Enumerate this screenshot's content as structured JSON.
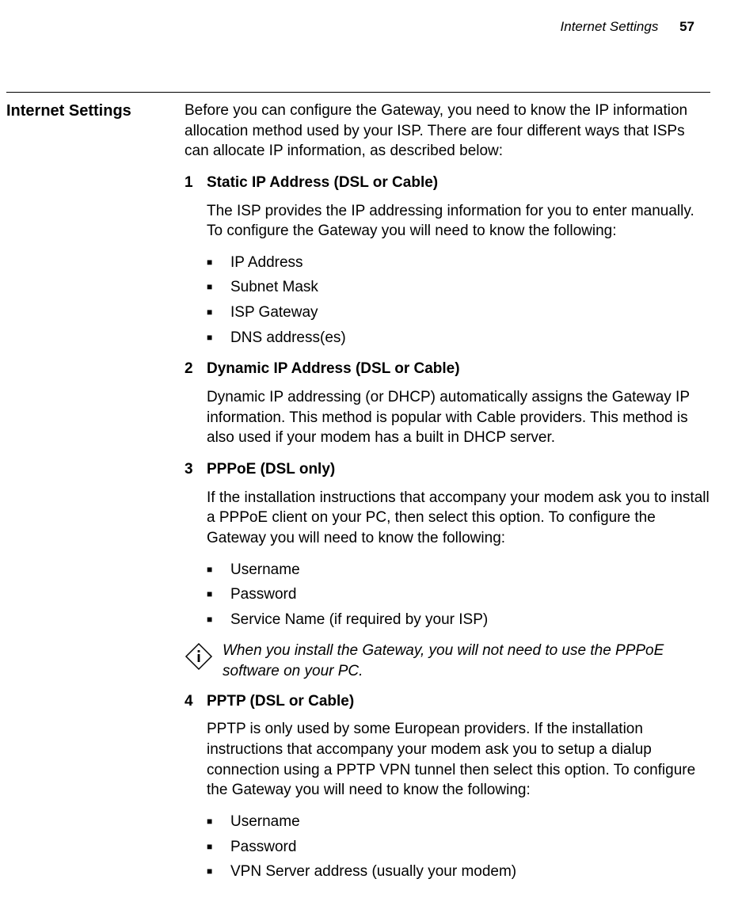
{
  "runningHead": {
    "title": "Internet Settings",
    "pageNumber": "57"
  },
  "sideHeading": "Internet Settings",
  "intro": "Before you can configure the Gateway, you need to know the IP information allocation method used by your ISP. There are four different ways that ISPs can allocate IP information, as described below:",
  "items": [
    {
      "num": "1",
      "title": "Static IP Address (DSL or Cable)",
      "para": "The ISP provides the IP addressing information for you to enter manually. To configure the Gateway you will need to know the following:",
      "bullets": [
        "IP Address",
        "Subnet Mask",
        "ISP Gateway",
        "DNS address(es)"
      ]
    },
    {
      "num": "2",
      "title": "Dynamic IP Address (DSL or Cable)",
      "para": "Dynamic IP addressing (or DHCP) automatically assigns the Gateway IP information. This method is popular with Cable providers. This method is also used if your modem has a built in DHCP server.",
      "bullets": []
    },
    {
      "num": "3",
      "title": "PPPoE (DSL only)",
      "para": "If the installation instructions that accompany your modem ask you to install a PPPoE client on your PC, then select this option. To configure the Gateway you will need to know the following:",
      "bullets": [
        "Username",
        "Password",
        "Service Name (if required by your ISP)"
      ]
    }
  ],
  "note": "When you install the Gateway, you will not need to use the PPPoE software on your PC.",
  "items2": [
    {
      "num": "4",
      "title": "PPTP (DSL or Cable)",
      "para": "PPTP is only used by some European providers. If the installation instructions that accompany your modem ask you to setup a dialup connection using a PPTP VPN tunnel then select this option. To configure the Gateway you will need to know the following:",
      "bullets": [
        "Username",
        "Password",
        "VPN Server address (usually your modem)"
      ]
    }
  ]
}
